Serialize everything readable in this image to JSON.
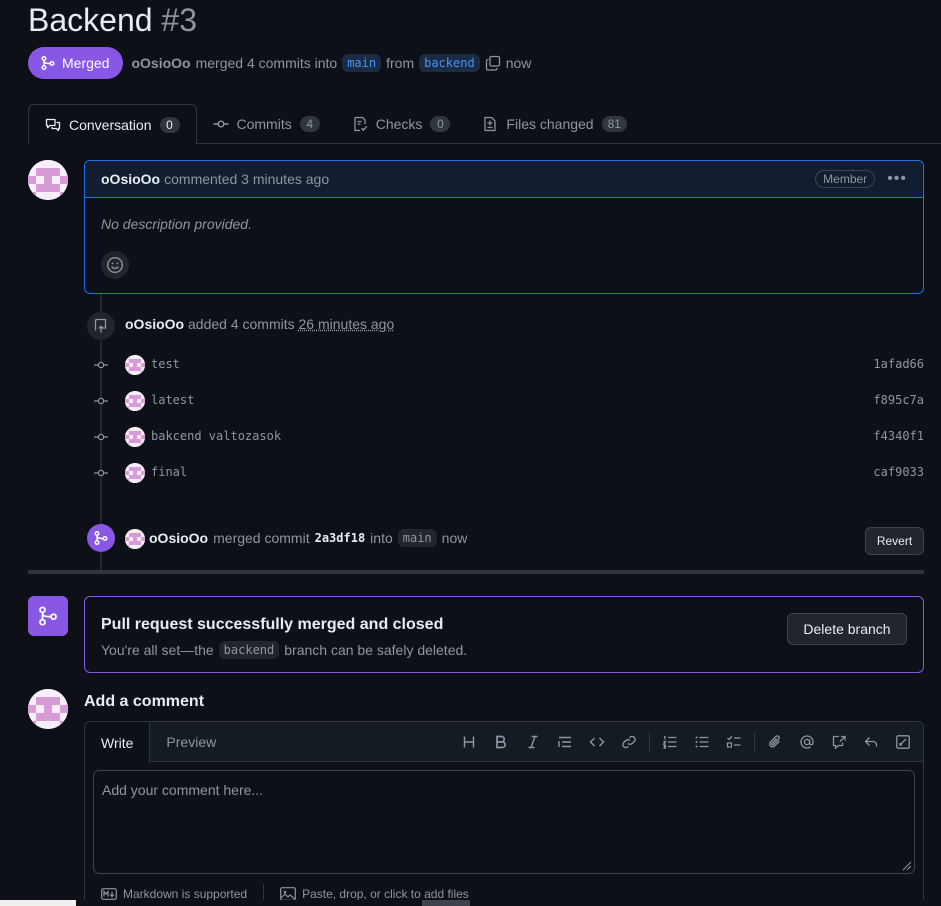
{
  "header": {
    "title": "Backend",
    "number": "#3",
    "state_label": "Merged",
    "author": "oOsioOo",
    "action": "merged 4 commits into",
    "base_branch": "main",
    "from_text": "from",
    "head_branch": "backend",
    "time": "now"
  },
  "tabs": [
    {
      "label": "Conversation",
      "count": "0",
      "icon": "comment-discussion-icon"
    },
    {
      "label": "Commits",
      "count": "4",
      "icon": "git-commit-icon"
    },
    {
      "label": "Checks",
      "count": "0",
      "icon": "checklist-icon"
    },
    {
      "label": "Files changed",
      "count": "81",
      "icon": "file-diff-icon"
    }
  ],
  "comment": {
    "author": "oOsioOo",
    "meta": "commented 3 minutes ago",
    "badge": "Member",
    "body": "No description provided."
  },
  "commits_event": {
    "author": "oOsioOo",
    "action": "added 4 commits",
    "time": "26 minutes ago"
  },
  "commits": [
    {
      "message": "test",
      "sha": "1afad66"
    },
    {
      "message": "latest",
      "sha": "f895c7a"
    },
    {
      "message": "bakcend valtozasok",
      "sha": "f4340f1"
    },
    {
      "message": "final",
      "sha": "caf9033"
    }
  ],
  "merge_event": {
    "author": "oOsioOo",
    "action": "merged commit",
    "sha": "2a3df18",
    "into": "into",
    "branch": "main",
    "time": "now",
    "revert_label": "Revert"
  },
  "merged_box": {
    "title": "Pull request successfully merged and closed",
    "text_before": "You're all set—the",
    "branch": "backend",
    "text_after": "branch can be safely deleted.",
    "delete_label": "Delete branch"
  },
  "add_comment": {
    "title": "Add a comment",
    "write_tab": "Write",
    "preview_tab": "Preview",
    "placeholder": "Add your comment here...",
    "markdown_note": "Markdown is supported",
    "attach_note": "Paste, drop, or click to add files"
  },
  "colors": {
    "merged": "#8957e5",
    "background": "#0d1117",
    "accent_blue": "#1f6feb"
  }
}
